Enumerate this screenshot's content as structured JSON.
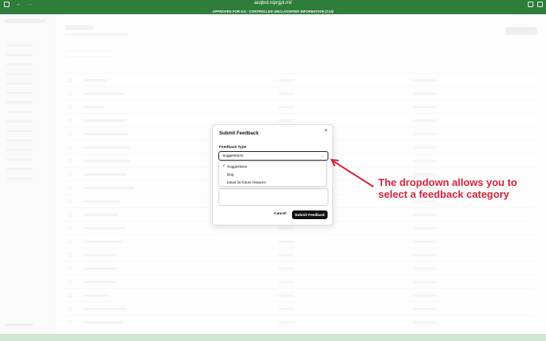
{
  "browser": {
    "url": "acqbot.niprgpt.mil",
    "back_icon": "back-arrow-icon",
    "forward_icon": "forward-arrow-icon"
  },
  "banner": {
    "text": "APPROVED FOR IL5 - CONTROLLED UNCLASSIFIED INFORMATION (CUI)"
  },
  "modal": {
    "title": "Submit Feedback",
    "close_label": "×",
    "field_label": "Feedback Type",
    "selected_value": "Suggestions",
    "options": [
      {
        "label": "Suggestions",
        "selected": true
      },
      {
        "label": "Bug",
        "selected": false
      },
      {
        "label": "Ideas for future features",
        "selected": false
      }
    ],
    "cancel_label": "Cancel",
    "submit_label": "Submit Feedback"
  },
  "annotation": {
    "line1": "The dropdown allows you to",
    "line2": "select a feedback category",
    "color": "#d4243b"
  },
  "colors": {
    "banner": "#2e7d3b",
    "primary_button": "#111111"
  }
}
